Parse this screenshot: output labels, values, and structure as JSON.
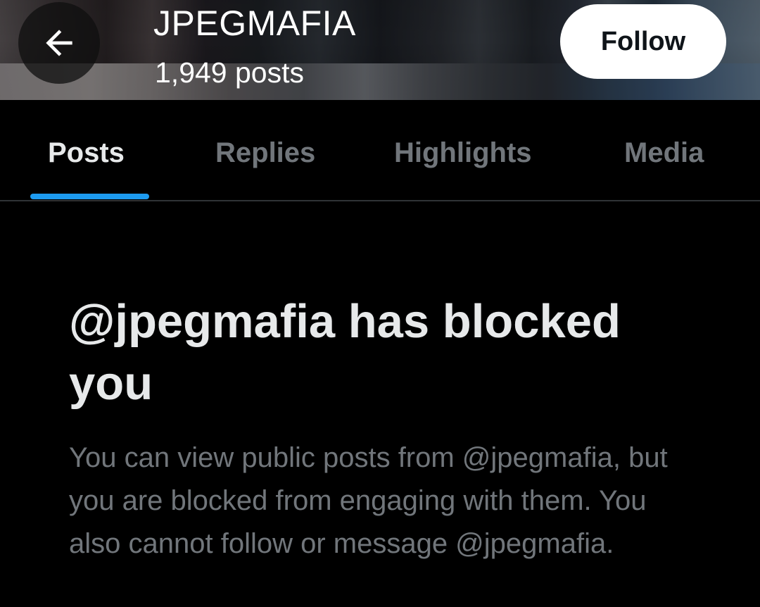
{
  "header": {
    "title": "JPEGMAFIA",
    "post_count": "1,949 posts",
    "back_icon": "arrow-left-icon",
    "follow_label": "Follow"
  },
  "tabs": [
    {
      "label": "Posts",
      "active": true
    },
    {
      "label": "Replies",
      "active": false
    },
    {
      "label": "Highlights",
      "active": false
    },
    {
      "label": "Media",
      "active": false
    }
  ],
  "notice": {
    "title": "@jpegmafia has blocked you",
    "body": "You can view public posts from @jpegmafia, but you are blocked from engaging with them. You also cannot follow or message @jpegmafia."
  },
  "colors": {
    "background": "#000000",
    "accent": "#1d9bf0",
    "text_primary": "#e7e9ea",
    "text_secondary": "#71767b",
    "follow_button_bg": "#ffffff",
    "divider": "#2f3336"
  }
}
